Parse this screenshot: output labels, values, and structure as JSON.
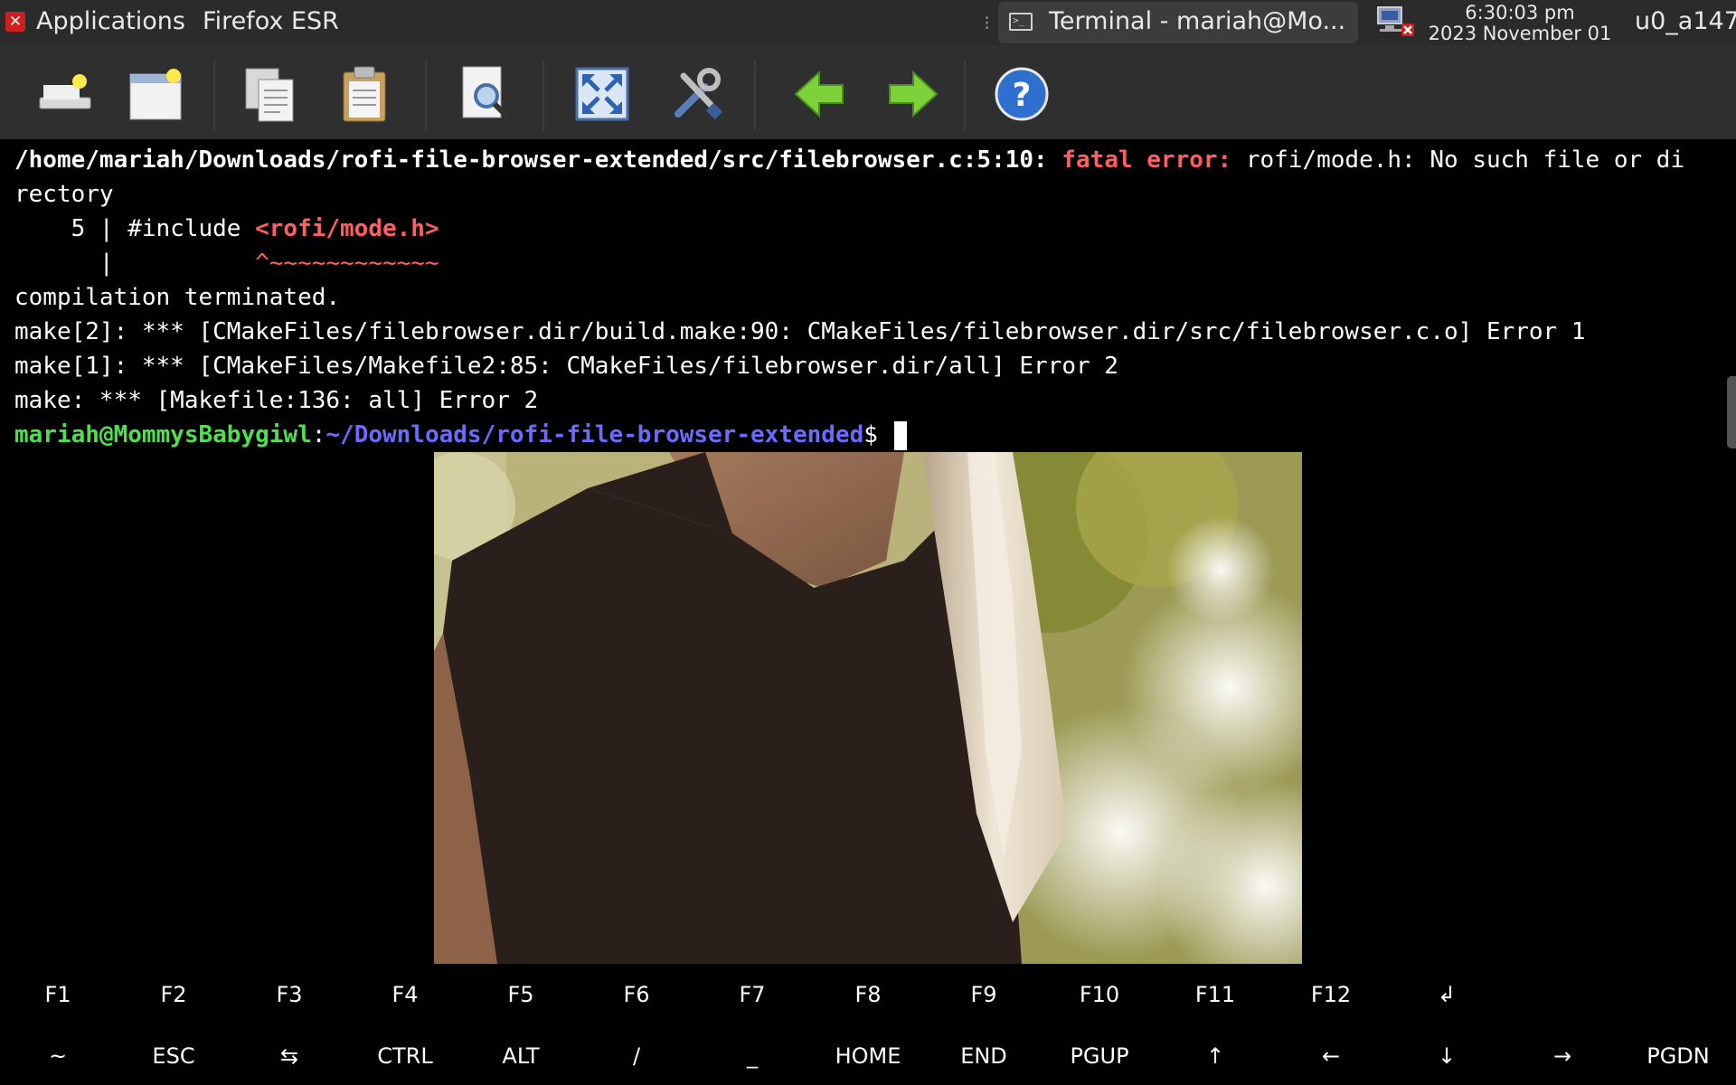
{
  "panel": {
    "applications_label": "Applications",
    "firefox_label": "Firefox ESR",
    "task_label": "Terminal - mariah@Mo...",
    "clock_time": "6:30:03 pm",
    "clock_date": "2023 November 01",
    "user_label": "u0_a147"
  },
  "toolbar": {
    "buttons": [
      "new-tab-icon",
      "new-window-icon",
      "copy-icon",
      "paste-icon",
      "find-icon",
      "fullscreen-icon",
      "preferences-icon",
      "back-icon",
      "forward-icon",
      "help-icon"
    ]
  },
  "terminal": {
    "line1_path": "/home/mariah/Downloads/rofi-file-browser-extended/src/filebrowser.c:5:10: ",
    "line1_error": "fatal error: ",
    "line1_msg": "rofi/mode.h: No such file or di",
    "line2": "rectory",
    "line3_prefix": "    5 | #include ",
    "line3_header": "<rofi/mode.h>",
    "line4_prefix": "      |          ",
    "line4_caret": "^~~~~~~~~~~~~",
    "line5": "compilation terminated.",
    "line6": "make[2]: *** [CMakeFiles/filebrowser.dir/build.make:90: CMakeFiles/filebrowser.dir/src/filebrowser.c.o] Error 1",
    "line7": "make[1]: *** [CMakeFiles/Makefile2:85: CMakeFiles/filebrowser.dir/all] Error 2",
    "line8": "make: *** [Makefile:136: all] Error 2",
    "prompt_user": "mariah@MommysBabygiwl",
    "prompt_colon": ":",
    "prompt_path": "~/Downloads/rofi-file-browser-extended",
    "prompt_dollar": "$ "
  },
  "keys": {
    "row1": [
      "F1",
      "F2",
      "F3",
      "F4",
      "F5",
      "F6",
      "F7",
      "F8",
      "F9",
      "F10",
      "F11",
      "F12",
      "↲"
    ],
    "row2": [
      "~",
      "ESC",
      "⇆",
      "CTRL",
      "ALT",
      "/",
      "_",
      "HOME",
      "END",
      "PGUP",
      "↑",
      "←",
      "↓",
      "→",
      "PGDN"
    ]
  },
  "colors": {
    "error_red": "#ff5f5f",
    "prompt_green": "#4ee14e",
    "prompt_blue": "#6b6bff",
    "panel_bg": "#2b2b2b",
    "toolbar_bg": "#2f2f2f"
  }
}
